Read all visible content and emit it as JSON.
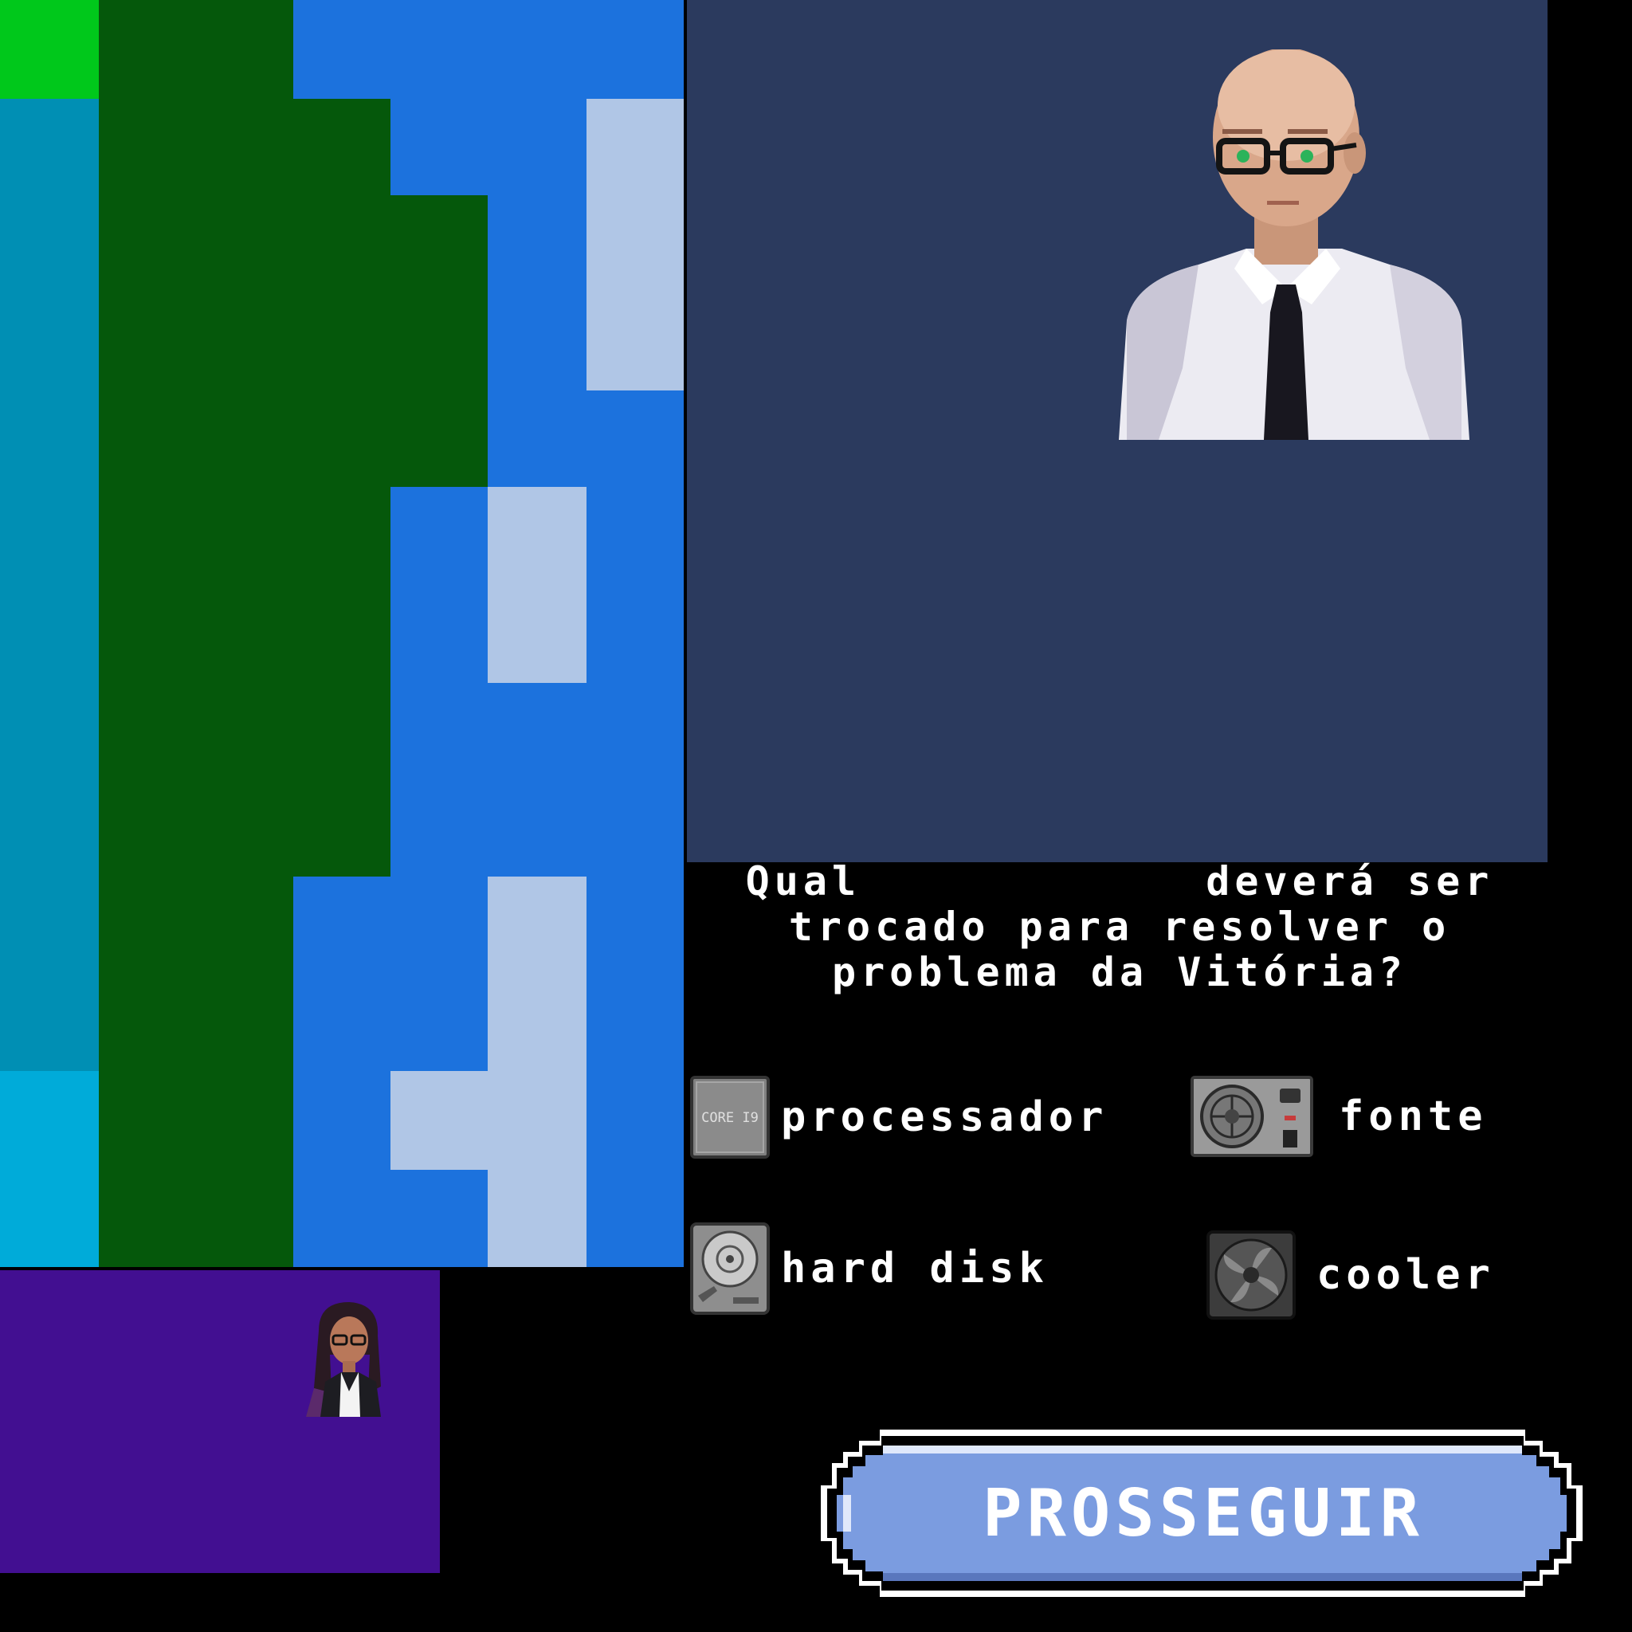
{
  "question": {
    "line1": "Qual            deverá ser",
    "line2": "trocado para resolver o",
    "line3": "problema da Vitória?"
  },
  "options": {
    "processador": {
      "label": "processador",
      "icon_text": "CORE I9",
      "icon": "cpu-chip-icon"
    },
    "fonte": {
      "label": "fonte",
      "icon": "power-supply-icon"
    },
    "hard_disk": {
      "label": "hard disk",
      "icon": "hard-disk-icon"
    },
    "cooler": {
      "label": "cooler",
      "icon": "cooler-fan-icon"
    }
  },
  "button": {
    "label": "PROSSEGUIR",
    "color": "#7b9ce0"
  },
  "characters": {
    "npc": "bald man with glasses, white shirt and black tie",
    "player": "woman with long dark hair, glasses and black blazer"
  },
  "colors": {
    "scene_bg": "#2b3a5e",
    "player_panel_bg": "#420f91",
    "grass_dark": "#05580b",
    "grass_light": "#00c81b",
    "water": "#1c72dd",
    "water_teal": "#008fb4",
    "water_cyan": "#00abd9",
    "ice": "#b0c6e6"
  }
}
